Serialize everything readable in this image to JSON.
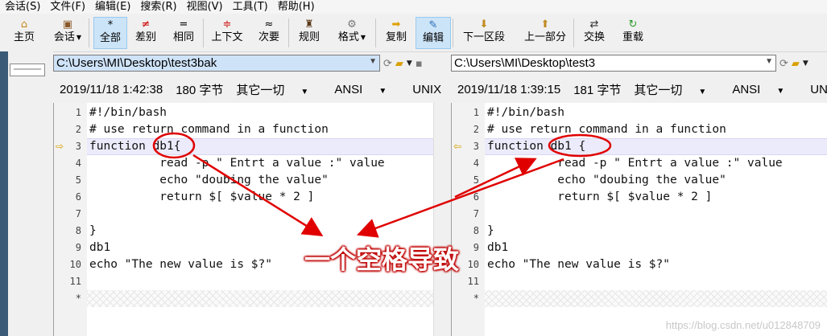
{
  "menu": [
    "会话(S)",
    "文件(F)",
    "编辑(E)",
    "搜索(R)",
    "视图(V)",
    "工具(T)",
    "帮助(H)"
  ],
  "toolbar": [
    {
      "label": "主页",
      "icon": "home-icon",
      "glyph": "⌂",
      "color": "#c68a1b",
      "caret": false
    },
    {
      "label": "会话",
      "icon": "briefcase-icon",
      "glyph": "▣",
      "color": "#8a5a2b",
      "caret": true
    },
    {
      "label": "全部",
      "icon": "asterisk-icon",
      "glyph": "*",
      "color": "#000000",
      "caret": false,
      "active": true
    },
    {
      "label": "差别",
      "icon": "not-equal-icon",
      "glyph": "≠",
      "color": "#cc0000",
      "caret": false
    },
    {
      "label": "相同",
      "icon": "equal-icon",
      "glyph": "=",
      "color": "#000000",
      "caret": false
    },
    {
      "label": "上下文",
      "icon": "context-icon",
      "glyph": "≑",
      "color": "#cc0000",
      "caret": false
    },
    {
      "label": "次要",
      "icon": "approx-icon",
      "glyph": "≈",
      "color": "#000000",
      "caret": false
    },
    {
      "label": "规则",
      "icon": "person-icon",
      "glyph": "♜",
      "color": "#5a3a1a",
      "caret": false
    },
    {
      "label": "格式",
      "icon": "format-icon",
      "glyph": "⚙",
      "color": "#777777",
      "caret": true
    },
    {
      "label": "复制",
      "icon": "copy-arrow-icon",
      "glyph": "➡",
      "color": "#e0a000",
      "caret": false
    },
    {
      "label": "编辑",
      "icon": "edit-icon",
      "glyph": "✎",
      "color": "#2a6ab8",
      "caret": false,
      "active": true
    },
    {
      "label": "下一区段",
      "icon": "down-arrow-icon",
      "glyph": "⬇",
      "color": "#c08a20",
      "caret": false
    },
    {
      "label": "上一部分",
      "icon": "up-arrow-icon",
      "glyph": "⬆",
      "color": "#c08a20",
      "caret": false
    },
    {
      "label": "交换",
      "icon": "swap-icon",
      "glyph": "⇄",
      "color": "#333333",
      "caret": false
    },
    {
      "label": "重载",
      "icon": "reload-icon",
      "glyph": "↻",
      "color": "#2a9a2a",
      "caret": false
    }
  ],
  "left": {
    "path": "C:\\Users\\MI\\Desktop\\test3bak",
    "date": "2019/11/18 1:42:38",
    "size": "180 字节",
    "filter": "其它一切",
    "encoding": "ANSI",
    "eol": "UNIX",
    "lines": [
      {
        "n": "1",
        "t": "#!/bin/bash"
      },
      {
        "n": "2",
        "t": "# use return command in a function"
      },
      {
        "n": "3",
        "t": "function db1{"
      },
      {
        "n": "4",
        "t": "          read -p \" Entrt a value :\" value"
      },
      {
        "n": "5",
        "t": "          echo \"doubing the value\""
      },
      {
        "n": "6",
        "t": "          return $[ $value * 2 ]"
      },
      {
        "n": "7",
        "t": ""
      },
      {
        "n": "8",
        "t": "}"
      },
      {
        "n": "9",
        "t": "db1"
      },
      {
        "n": "10",
        "t": "echo \"The new value is $?\""
      },
      {
        "n": "11",
        "t": ""
      },
      {
        "n": "*",
        "t": ""
      }
    ]
  },
  "right": {
    "path": "C:\\Users\\MI\\Desktop\\test3",
    "date": "2019/11/18 1:39:15",
    "size": "181 字节",
    "filter": "其它一切",
    "encoding": "ANSI",
    "eol": "UNIX",
    "lines": [
      {
        "n": "1",
        "t": "#!/bin/bash"
      },
      {
        "n": "2",
        "t": "# use return command in a function"
      },
      {
        "n": "3",
        "t": "function db1 {"
      },
      {
        "n": "4",
        "t": "          read -p \" Entrt a value :\" value"
      },
      {
        "n": "5",
        "t": "          echo \"doubing the value\""
      },
      {
        "n": "6",
        "t": "          return $[ $value * 2 ]"
      },
      {
        "n": "7",
        "t": ""
      },
      {
        "n": "8",
        "t": "}"
      },
      {
        "n": "9",
        "t": "db1"
      },
      {
        "n": "10",
        "t": "echo \"The new value is $?\""
      },
      {
        "n": "11",
        "t": ""
      },
      {
        "n": "*",
        "t": ""
      }
    ]
  },
  "annotation": "一个空格导致",
  "watermark": "https://blog.csdn.net/u012848709",
  "colors": {
    "highlight": "#ecebfb",
    "annotation_red": "#e00000",
    "diff_marker": "#d8a000"
  }
}
